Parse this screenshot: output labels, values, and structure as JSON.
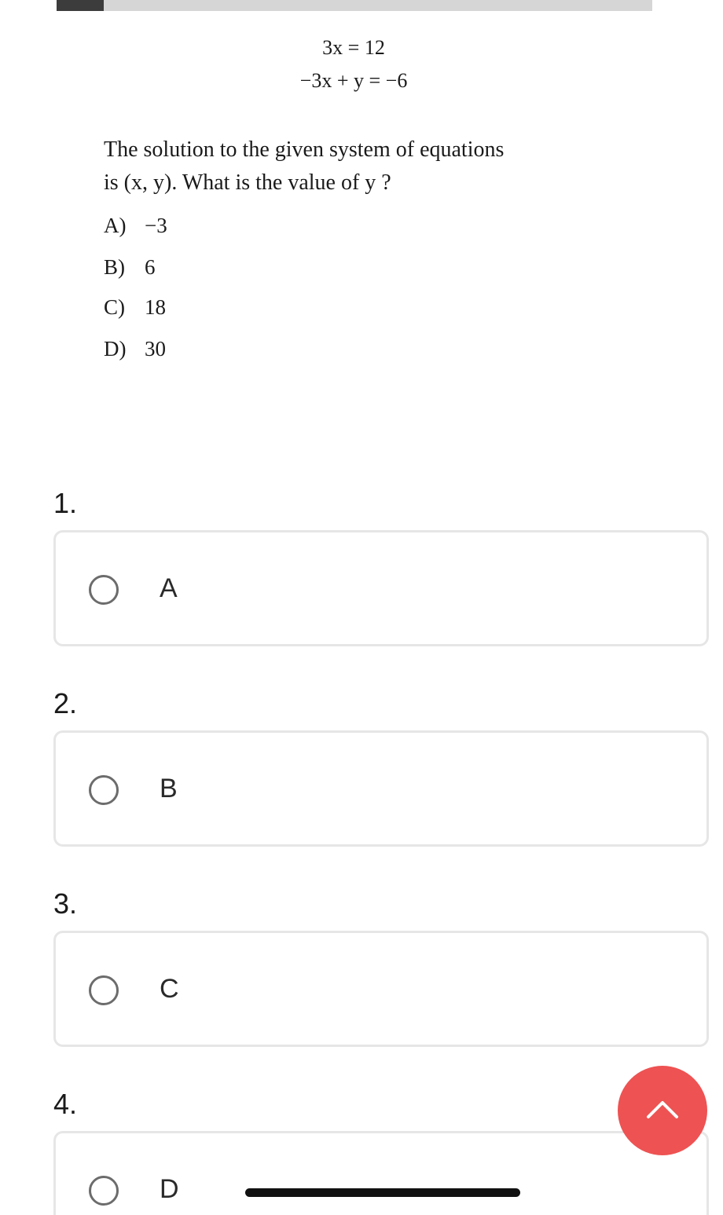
{
  "problem": {
    "equation1": "3x = 12",
    "equation2": "−3x + y = −6",
    "question_line1": "The solution to the given system of equations",
    "question_line2": "is (x, y). What is the value of y ?",
    "choices": [
      {
        "letter": "A)",
        "value": "−3"
      },
      {
        "letter": "B)",
        "value": "6"
      },
      {
        "letter": "C)",
        "value": "18"
      },
      {
        "letter": "D)",
        "value": "30"
      }
    ]
  },
  "answers": [
    {
      "number": "1.",
      "option": "A"
    },
    {
      "number": "2.",
      "option": "B"
    },
    {
      "number": "3.",
      "option": "C"
    },
    {
      "number": "4.",
      "option": "D"
    }
  ],
  "fab": {
    "icon": "chevron-up-icon",
    "color": "#ee5252"
  }
}
